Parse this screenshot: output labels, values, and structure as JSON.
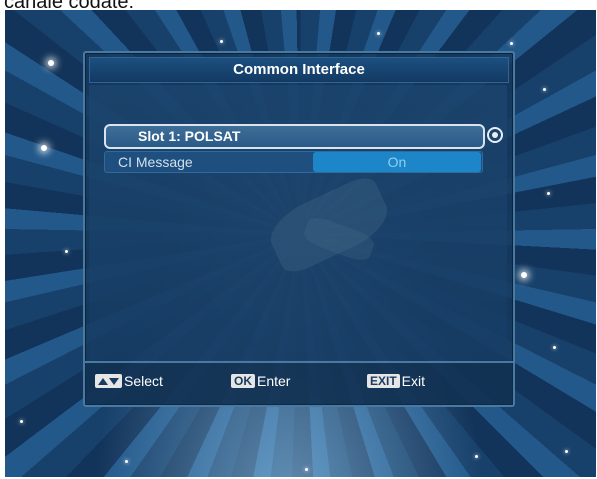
{
  "caption": "canale codate:",
  "dialog": {
    "title": "Common Interface",
    "slot_label": "Slot 1: POLSAT",
    "ci_message": {
      "label": "CI Message",
      "value": "On"
    }
  },
  "footer": {
    "select_label": "Select",
    "ok_key": "OK",
    "enter_label": "Enter",
    "exit_key": "EXIT",
    "exit_label": "Exit"
  },
  "colors": {
    "dialog_bg": "#16385c",
    "highlight": "#1c86c8",
    "border": "#4b7aa1"
  },
  "icons": {
    "up_down_key": "up-down-arrows-icon",
    "radio": "radio-selected-icon"
  }
}
